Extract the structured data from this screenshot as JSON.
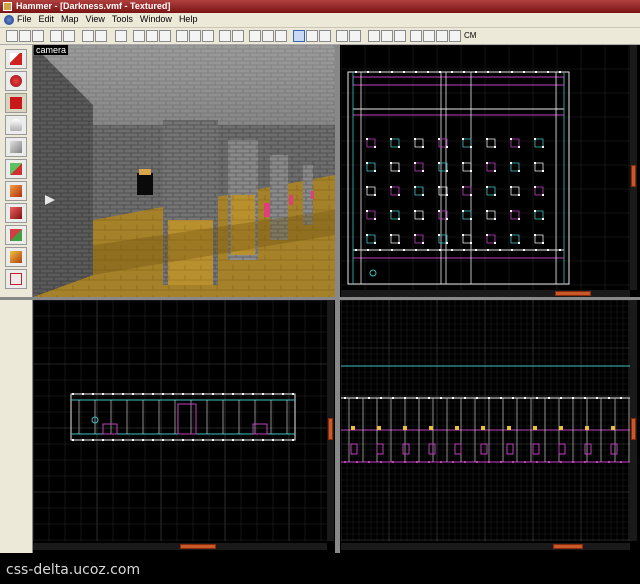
{
  "window": {
    "title": "Hammer - [Darkness.vmf - Textured]"
  },
  "menu": {
    "items": [
      "File",
      "Edit",
      "Map",
      "View",
      "Tools",
      "Window",
      "Help"
    ]
  },
  "toolbar": {
    "cm_label": "CM"
  },
  "viewports": {
    "camera_label": "camera"
  },
  "colors": {
    "selection_accent": "#c85a2a",
    "grid": "#3a3a3a",
    "wall_white": "#e8e8e8",
    "wall_pink": "#c040c0",
    "wall_cyan": "#40c0c0"
  },
  "watermark": {
    "text": "css-delta.ucoz.com"
  }
}
